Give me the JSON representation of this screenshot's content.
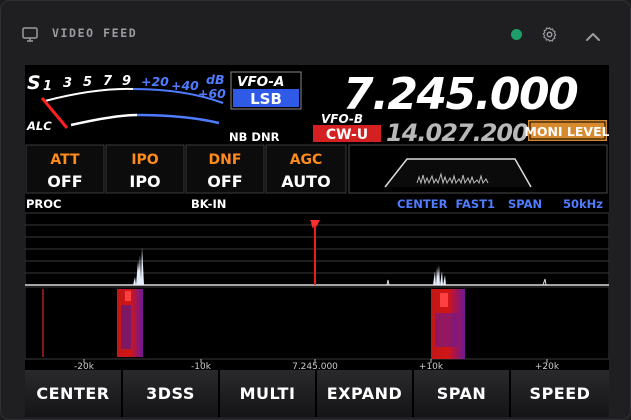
{
  "header": {
    "title": "VIDEO FEED",
    "status_color": "#1e9e6a",
    "icons": [
      "monitor-icon",
      "gear-icon",
      "chevron-up-icon"
    ]
  },
  "meter": {
    "s_label": "S",
    "scale_s": [
      "1",
      "3",
      "5",
      "7",
      "9"
    ],
    "scale_db": [
      "+20",
      "+40",
      "+60"
    ],
    "db_label": "dB",
    "alc_label": "ALC"
  },
  "vfo_a": {
    "label": "VFO-A",
    "mode": "LSB",
    "frequency": "7.245.000"
  },
  "vfo_b": {
    "label": "VFO-B",
    "mode": "CW-U",
    "frequency": "14.027.200"
  },
  "moni_level": "MONI LEVEL",
  "flags": "NB DNR",
  "functions": [
    {
      "label": "ATT",
      "value": "OFF"
    },
    {
      "label": "IPO",
      "value": "IPO"
    },
    {
      "label": "DNF",
      "value": "OFF"
    },
    {
      "label": "AGC",
      "value": "AUTO"
    }
  ],
  "status_row": {
    "left": "PROC",
    "middle": "BK-IN",
    "scope_mode": "CENTER  FAST1",
    "span_label": "SPAN",
    "span_value": "50kHz"
  },
  "freq_axis": [
    "-20k",
    "-10k",
    "7.245.000",
    "+10k",
    "+20k"
  ],
  "softkeys": [
    "CENTER",
    "3DSS",
    "MULTI",
    "EXPAND",
    "SPAN",
    "SPEED"
  ],
  "colors": {
    "freq_main": "#ffffff",
    "vfo_b_freq": "#b8b8b8",
    "mode_lsb_bg": "#2f5ae8",
    "mode_cwu_bg": "#d42020",
    "moni_bg": "#d88a2e",
    "function_label": "#ff8c1a",
    "scope_blue": "#4f7cff"
  }
}
